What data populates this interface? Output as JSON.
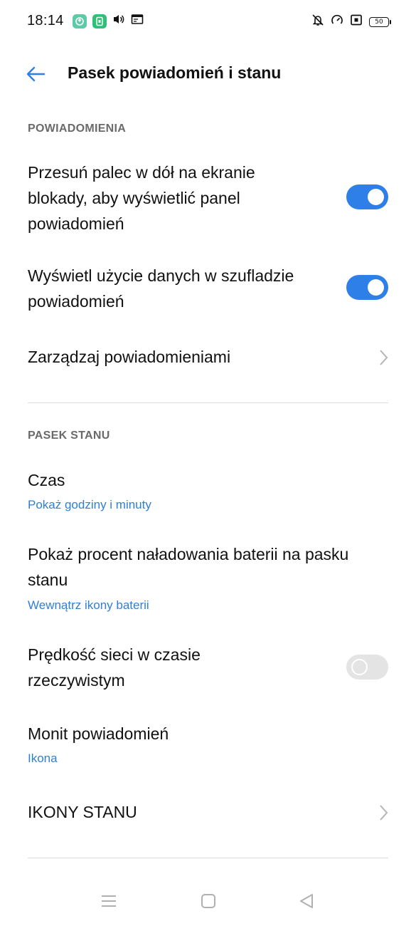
{
  "status_bar": {
    "time": "18:14",
    "battery_level": "50",
    "left_icons": [
      "app-icon-green-1",
      "app-icon-green-2",
      "volume-icon",
      "window-icon"
    ],
    "right_icons": [
      "bell-off-icon",
      "speedometer-icon",
      "nfc-icon",
      "battery-icon"
    ]
  },
  "header": {
    "title": "Pasek powiadomień i stanu",
    "back_icon": "arrow-left-icon"
  },
  "sections": {
    "notifications": {
      "label": "POWIADOMIENIA",
      "items": [
        {
          "title": "Przesuń palec w dół na ekranie blokady, aby wyświetlić panel powiadomień",
          "toggle": true
        },
        {
          "title": "Wyświetl użycie danych w szufladzie powiadomień",
          "toggle": true
        },
        {
          "title": "Zarządzaj powiadomieniami"
        }
      ]
    },
    "status_bar": {
      "label": "PASEK STANU",
      "items": [
        {
          "title": "Czas",
          "subtitle": "Pokaż godziny i minuty"
        },
        {
          "title": "Pokaż procent naładowania baterii na pasku stanu",
          "subtitle": "Wewnątrz ikony baterii"
        },
        {
          "title": "Prędkość sieci w czasie rzeczywistym",
          "toggle": false
        },
        {
          "title": "Monit powiadomień",
          "subtitle": "Ikona"
        },
        {
          "title": "IKONY STANU"
        }
      ]
    }
  },
  "colors": {
    "accent": "#2f7fe8",
    "subtitle": "#2f7fd6",
    "section_header": "#6a6a6a"
  },
  "nav_bar": {
    "icons": [
      "menu-icon",
      "home-square-icon",
      "back-triangle-icon"
    ]
  }
}
